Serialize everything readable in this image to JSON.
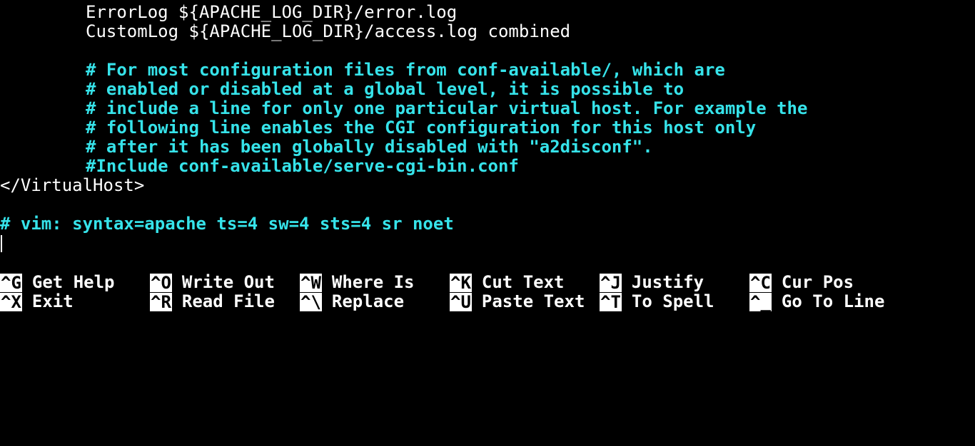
{
  "editor": {
    "lines": [
      {
        "indent": true,
        "style": "plain",
        "text": "ErrorLog ${APACHE_LOG_DIR}/error.log"
      },
      {
        "indent": true,
        "style": "plain",
        "text": "CustomLog ${APACHE_LOG_DIR}/access.log combined"
      },
      {
        "indent": false,
        "style": "plain",
        "text": ""
      },
      {
        "indent": true,
        "style": "comment",
        "text": "# For most configuration files from conf-available/, which are"
      },
      {
        "indent": true,
        "style": "comment",
        "text": "# enabled or disabled at a global level, it is possible to"
      },
      {
        "indent": true,
        "style": "comment",
        "text": "# include a line for only one particular virtual host. For example the"
      },
      {
        "indent": true,
        "style": "comment",
        "text": "# following line enables the CGI configuration for this host only"
      },
      {
        "indent": true,
        "style": "comment",
        "text": "# after it has been globally disabled with \"a2disconf\"."
      },
      {
        "indent": true,
        "style": "comment",
        "text": "#Include conf-available/serve-cgi-bin.conf"
      },
      {
        "indent": false,
        "style": "plain",
        "text": "</VirtualHost>"
      },
      {
        "indent": false,
        "style": "plain",
        "text": ""
      },
      {
        "indent": false,
        "style": "comment",
        "text": "# vim: syntax=apache ts=4 sw=4 sts=4 sr noet"
      }
    ]
  },
  "shortcuts": {
    "row1": [
      {
        "key": "^G",
        "label": "Get Help"
      },
      {
        "key": "^O",
        "label": "Write Out"
      },
      {
        "key": "^W",
        "label": "Where Is"
      },
      {
        "key": "^K",
        "label": "Cut Text"
      },
      {
        "key": "^J",
        "label": "Justify"
      },
      {
        "key": "^C",
        "label": "Cur Pos"
      }
    ],
    "row2": [
      {
        "key": "^X",
        "label": "Exit"
      },
      {
        "key": "^R",
        "label": "Read File"
      },
      {
        "key": "^\\",
        "label": "Replace"
      },
      {
        "key": "^U",
        "label": "Paste Text"
      },
      {
        "key": "^T",
        "label": "To Spell"
      },
      {
        "key": "^_",
        "label": "Go To Line"
      }
    ]
  },
  "colors": {
    "background": "#000000",
    "text": "#ffffff",
    "comment": "#36e3ea"
  }
}
